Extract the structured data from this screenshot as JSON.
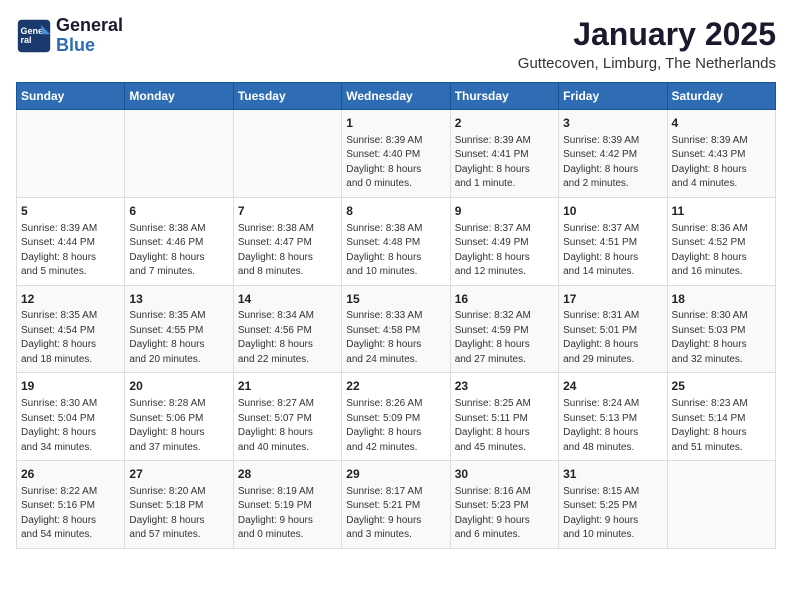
{
  "logo": {
    "line1": "General",
    "line2": "Blue"
  },
  "title": "January 2025",
  "subtitle": "Guttecoven, Limburg, The Netherlands",
  "weekdays": [
    "Sunday",
    "Monday",
    "Tuesday",
    "Wednesday",
    "Thursday",
    "Friday",
    "Saturday"
  ],
  "weeks": [
    [
      {
        "day": "",
        "info": ""
      },
      {
        "day": "",
        "info": ""
      },
      {
        "day": "",
        "info": ""
      },
      {
        "day": "1",
        "info": "Sunrise: 8:39 AM\nSunset: 4:40 PM\nDaylight: 8 hours\nand 0 minutes."
      },
      {
        "day": "2",
        "info": "Sunrise: 8:39 AM\nSunset: 4:41 PM\nDaylight: 8 hours\nand 1 minute."
      },
      {
        "day": "3",
        "info": "Sunrise: 8:39 AM\nSunset: 4:42 PM\nDaylight: 8 hours\nand 2 minutes."
      },
      {
        "day": "4",
        "info": "Sunrise: 8:39 AM\nSunset: 4:43 PM\nDaylight: 8 hours\nand 4 minutes."
      }
    ],
    [
      {
        "day": "5",
        "info": "Sunrise: 8:39 AM\nSunset: 4:44 PM\nDaylight: 8 hours\nand 5 minutes."
      },
      {
        "day": "6",
        "info": "Sunrise: 8:38 AM\nSunset: 4:46 PM\nDaylight: 8 hours\nand 7 minutes."
      },
      {
        "day": "7",
        "info": "Sunrise: 8:38 AM\nSunset: 4:47 PM\nDaylight: 8 hours\nand 8 minutes."
      },
      {
        "day": "8",
        "info": "Sunrise: 8:38 AM\nSunset: 4:48 PM\nDaylight: 8 hours\nand 10 minutes."
      },
      {
        "day": "9",
        "info": "Sunrise: 8:37 AM\nSunset: 4:49 PM\nDaylight: 8 hours\nand 12 minutes."
      },
      {
        "day": "10",
        "info": "Sunrise: 8:37 AM\nSunset: 4:51 PM\nDaylight: 8 hours\nand 14 minutes."
      },
      {
        "day": "11",
        "info": "Sunrise: 8:36 AM\nSunset: 4:52 PM\nDaylight: 8 hours\nand 16 minutes."
      }
    ],
    [
      {
        "day": "12",
        "info": "Sunrise: 8:35 AM\nSunset: 4:54 PM\nDaylight: 8 hours\nand 18 minutes."
      },
      {
        "day": "13",
        "info": "Sunrise: 8:35 AM\nSunset: 4:55 PM\nDaylight: 8 hours\nand 20 minutes."
      },
      {
        "day": "14",
        "info": "Sunrise: 8:34 AM\nSunset: 4:56 PM\nDaylight: 8 hours\nand 22 minutes."
      },
      {
        "day": "15",
        "info": "Sunrise: 8:33 AM\nSunset: 4:58 PM\nDaylight: 8 hours\nand 24 minutes."
      },
      {
        "day": "16",
        "info": "Sunrise: 8:32 AM\nSunset: 4:59 PM\nDaylight: 8 hours\nand 27 minutes."
      },
      {
        "day": "17",
        "info": "Sunrise: 8:31 AM\nSunset: 5:01 PM\nDaylight: 8 hours\nand 29 minutes."
      },
      {
        "day": "18",
        "info": "Sunrise: 8:30 AM\nSunset: 5:03 PM\nDaylight: 8 hours\nand 32 minutes."
      }
    ],
    [
      {
        "day": "19",
        "info": "Sunrise: 8:30 AM\nSunset: 5:04 PM\nDaylight: 8 hours\nand 34 minutes."
      },
      {
        "day": "20",
        "info": "Sunrise: 8:28 AM\nSunset: 5:06 PM\nDaylight: 8 hours\nand 37 minutes."
      },
      {
        "day": "21",
        "info": "Sunrise: 8:27 AM\nSunset: 5:07 PM\nDaylight: 8 hours\nand 40 minutes."
      },
      {
        "day": "22",
        "info": "Sunrise: 8:26 AM\nSunset: 5:09 PM\nDaylight: 8 hours\nand 42 minutes."
      },
      {
        "day": "23",
        "info": "Sunrise: 8:25 AM\nSunset: 5:11 PM\nDaylight: 8 hours\nand 45 minutes."
      },
      {
        "day": "24",
        "info": "Sunrise: 8:24 AM\nSunset: 5:13 PM\nDaylight: 8 hours\nand 48 minutes."
      },
      {
        "day": "25",
        "info": "Sunrise: 8:23 AM\nSunset: 5:14 PM\nDaylight: 8 hours\nand 51 minutes."
      }
    ],
    [
      {
        "day": "26",
        "info": "Sunrise: 8:22 AM\nSunset: 5:16 PM\nDaylight: 8 hours\nand 54 minutes."
      },
      {
        "day": "27",
        "info": "Sunrise: 8:20 AM\nSunset: 5:18 PM\nDaylight: 8 hours\nand 57 minutes."
      },
      {
        "day": "28",
        "info": "Sunrise: 8:19 AM\nSunset: 5:19 PM\nDaylight: 9 hours\nand 0 minutes."
      },
      {
        "day": "29",
        "info": "Sunrise: 8:17 AM\nSunset: 5:21 PM\nDaylight: 9 hours\nand 3 minutes."
      },
      {
        "day": "30",
        "info": "Sunrise: 8:16 AM\nSunset: 5:23 PM\nDaylight: 9 hours\nand 6 minutes."
      },
      {
        "day": "31",
        "info": "Sunrise: 8:15 AM\nSunset: 5:25 PM\nDaylight: 9 hours\nand 10 minutes."
      },
      {
        "day": "",
        "info": ""
      }
    ]
  ]
}
